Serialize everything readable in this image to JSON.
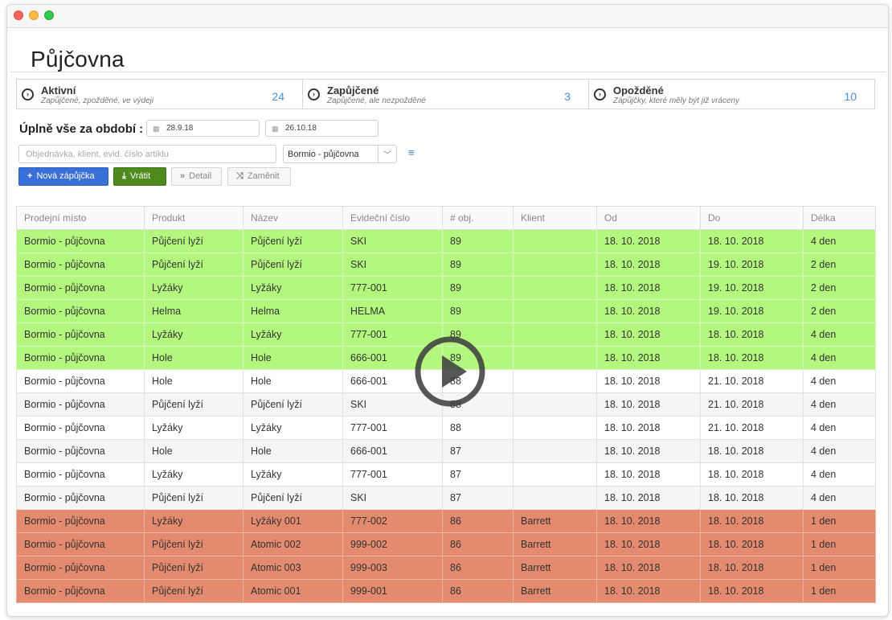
{
  "page_title": "Půjčovna",
  "stats": [
    {
      "label": "Aktivní",
      "sub": "Zapůjčené, zpožděné, ve výdeji",
      "count": "24"
    },
    {
      "label": "Zapůjčené",
      "sub": "Zapůjčené, ale nezpožděné",
      "count": "3"
    },
    {
      "label": "Opožděné",
      "sub": "Zápůjčky, které měly být již vráceny",
      "count": "10"
    }
  ],
  "filter": {
    "period_label": "Úplně vše za období :",
    "date_from": "28.9.18",
    "date_to": "26.10.18",
    "search_placeholder": "Objednávka, klient, evid. číslo artiklu",
    "location": "Bormio - půjčovna"
  },
  "actions": {
    "new_loan": "Nová zápůjčka",
    "return": "Vrátit",
    "detail": "Detail",
    "swap": "Zaměnit"
  },
  "table": {
    "headers": [
      "Prodejní místo",
      "Produkt",
      "Název",
      "Evideční číslo",
      "# obj.",
      "Klient",
      "Od",
      "Do",
      "Délka"
    ],
    "rows": [
      {
        "status": "green",
        "cells": [
          "Bormio - půjčovna",
          "Půjčení lyží",
          "Půjčení lyží",
          "SKI",
          "89",
          "",
          "18. 10. 2018",
          "18. 10. 2018",
          "4 den"
        ]
      },
      {
        "status": "green",
        "cells": [
          "Bormio - půjčovna",
          "Půjčení lyží",
          "Půjčení lyží",
          "SKI",
          "89",
          "",
          "18. 10. 2018",
          "19. 10. 2018",
          "2 den"
        ]
      },
      {
        "status": "green",
        "cells": [
          "Bormio - půjčovna",
          "Lyžáky",
          "Lyžáky",
          "777-001",
          "89",
          "",
          "18. 10. 2018",
          "19. 10. 2018",
          "2 den"
        ]
      },
      {
        "status": "green",
        "cells": [
          "Bormio - půjčovna",
          "Helma",
          "Helma",
          "HELMA",
          "89",
          "",
          "18. 10. 2018",
          "19. 10. 2018",
          "2 den"
        ]
      },
      {
        "status": "green",
        "cells": [
          "Bormio - půjčovna",
          "Lyžáky",
          "Lyžáky",
          "777-001",
          "89",
          "",
          "18. 10. 2018",
          "18. 10. 2018",
          "4 den"
        ]
      },
      {
        "status": "green",
        "cells": [
          "Bormio - půjčovna",
          "Hole",
          "Hole",
          "666-001",
          "89",
          "",
          "18. 10. 2018",
          "18. 10. 2018",
          "4 den"
        ]
      },
      {
        "status": "white",
        "cells": [
          "Bormio - půjčovna",
          "Hole",
          "Hole",
          "666-001",
          "88",
          "",
          "18. 10. 2018",
          "21. 10. 2018",
          "4 den"
        ]
      },
      {
        "status": "gray",
        "cells": [
          "Bormio - půjčovna",
          "Půjčení lyží",
          "Půjčení lyží",
          "SKI",
          "88",
          "",
          "18. 10. 2018",
          "21. 10. 2018",
          "4 den"
        ]
      },
      {
        "status": "white",
        "cells": [
          "Bormio - půjčovna",
          "Lyžáky",
          "Lyžáky",
          "777-001",
          "88",
          "",
          "18. 10. 2018",
          "21. 10. 2018",
          "4 den"
        ]
      },
      {
        "status": "gray",
        "cells": [
          "Bormio - půjčovna",
          "Hole",
          "Hole",
          "666-001",
          "87",
          "",
          "18. 10. 2018",
          "18. 10. 2018",
          "4 den"
        ]
      },
      {
        "status": "white",
        "cells": [
          "Bormio - půjčovna",
          "Lyžáky",
          "Lyžáky",
          "777-001",
          "87",
          "",
          "18. 10. 2018",
          "18. 10. 2018",
          "4 den"
        ]
      },
      {
        "status": "gray",
        "cells": [
          "Bormio - půjčovna",
          "Půjčení lyží",
          "Půjčení lyží",
          "SKI",
          "87",
          "",
          "18. 10. 2018",
          "18. 10. 2018",
          "4 den"
        ]
      },
      {
        "status": "red",
        "cells": [
          "Bormio - půjčovna",
          "Lyžáky",
          "Lyžáky 001",
          "777-002",
          "86",
          "Barrett",
          "18. 10. 2018",
          "18. 10. 2018",
          "1 den"
        ]
      },
      {
        "status": "red",
        "cells": [
          "Bormio - půjčovna",
          "Půjčení lyží",
          "Atomic 002",
          "999-002",
          "86",
          "Barrett",
          "18. 10. 2018",
          "18. 10. 2018",
          "1 den"
        ]
      },
      {
        "status": "red",
        "cells": [
          "Bormio - půjčovna",
          "Půjčení lyží",
          "Atomic 003",
          "999-003",
          "86",
          "Barrett",
          "18. 10. 2018",
          "18. 10. 2018",
          "1 den"
        ]
      },
      {
        "status": "red",
        "cells": [
          "Bormio - půjčovna",
          "Půjčení lyží",
          "Atomic 001",
          "999-001",
          "86",
          "Barrett",
          "18. 10. 2018",
          "18. 10. 2018",
          "1 den"
        ]
      }
    ]
  },
  "colors": {
    "accent": "#4a90d9",
    "primary_button": "#3a6fd8",
    "success_button": "#4e8a1e",
    "row_active": "#b4f77e",
    "row_overdue": "#e48a6e"
  },
  "icons": {
    "stat": "circle-arrow-right-icon",
    "calendar": "calendar-icon",
    "play": "play-icon"
  }
}
